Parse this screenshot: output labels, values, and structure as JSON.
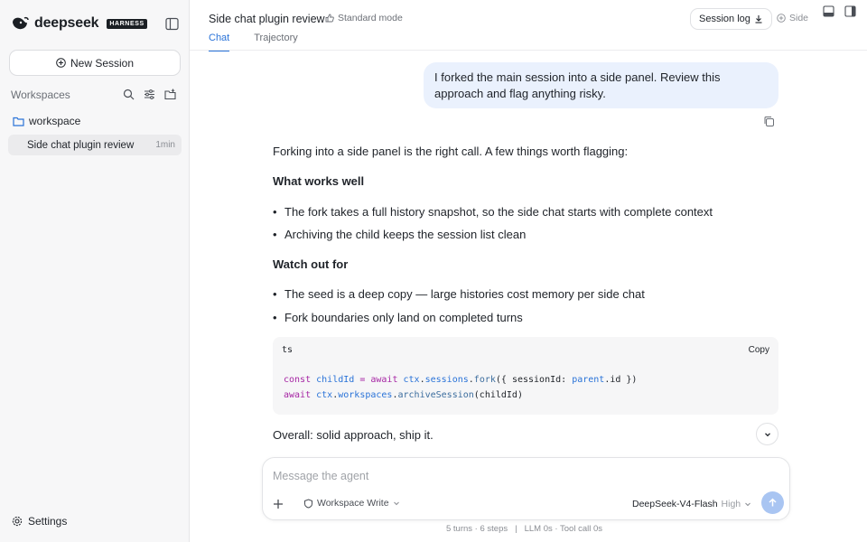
{
  "brand": {
    "name": "deepseek",
    "badge": "HARNESS"
  },
  "sidebar": {
    "new_session_label": "New Session",
    "workspaces_label": "Workspaces",
    "folder_name": "workspace",
    "sessions": [
      {
        "title": "Side chat plugin review",
        "time": "1min"
      }
    ],
    "settings_label": "Settings"
  },
  "header": {
    "title": "Side chat plugin review",
    "mode": "Standard mode",
    "tabs": [
      {
        "label": "Chat",
        "active": true
      },
      {
        "label": "Trajectory",
        "active": false
      }
    ],
    "session_log_label": "Session log",
    "side_label": "Side"
  },
  "chat": {
    "user_message": "I forked the main session into a side panel. Review this approach and flag anything risky.",
    "intro": "Forking into a side panel is the right call. A few things worth flagging:",
    "section1_title": "What works well",
    "section1_items": [
      "The fork takes a full history snapshot, so the side chat starts with complete context",
      "Archiving the child keeps the session list clean"
    ],
    "section2_title": "Watch out for",
    "section2_items": [
      "The seed is a deep copy — large histories cost memory per side chat",
      "Fork boundaries only land on completed turns"
    ],
    "code": {
      "lang": "ts",
      "copy_label": "Copy",
      "line1": {
        "kw": "const",
        "var": "childId",
        "op": " = ",
        "kw2": "await",
        "obj": "ctx",
        "prop": "sessions",
        "fn": "fork",
        "rest_a": "({ sessionId: ",
        "arg": "parent",
        "rest_b": ".id })"
      },
      "line2": {
        "kw": "await",
        "obj": "ctx",
        "prop": "workspaces",
        "fn": "archiveSession",
        "rest": "(childId)"
      }
    },
    "outro": "Overall: solid approach, ship it."
  },
  "composer": {
    "placeholder": "Message the agent",
    "permission": "Workspace Write",
    "model": "DeepSeek-V4-Flash",
    "level": "High"
  },
  "footer": {
    "turns": "5 turns · 6 steps",
    "separator": "|",
    "timing": "LLM 0s · Tool call 0s"
  },
  "colors": {
    "accent": "#2a73d8",
    "user_bubble": "#eaf1fd",
    "send_button": "#a9c5f2"
  }
}
